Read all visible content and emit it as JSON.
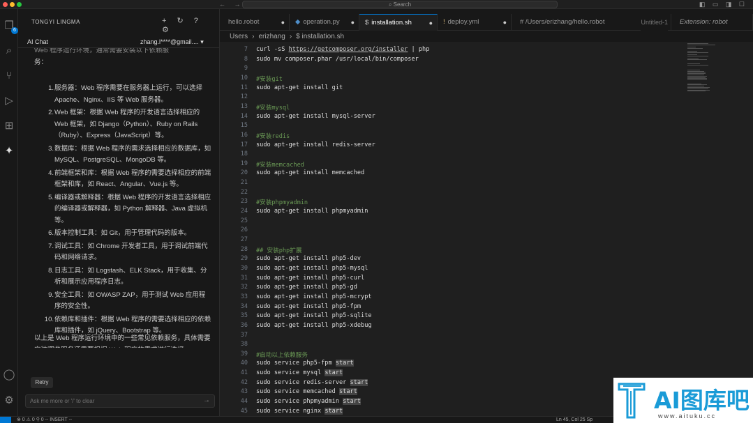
{
  "window": {
    "search_placeholder": "Search",
    "nav_back": "←",
    "nav_forward": "→",
    "layout_icons": "◧ ▭ ◨ ☐"
  },
  "activity_bar": {
    "explorer_badge": "6"
  },
  "sidebar": {
    "title": "TONGYI LINGMA",
    "actions": "+ ↻ ? ⚙",
    "chat_label": "AI Chat",
    "account": "zhang.l****@gmail....",
    "chat_top_line": "Web 程序运行环境，通常需要安装以下依赖服",
    "chat_top_line2": "务：",
    "chat_items": [
      {
        "n": "1.",
        "text": "服务器：Web 程序需要在服务器上运行，可以选择 Apache、Nginx、IIS 等 Web 服务器。"
      },
      {
        "n": "2.",
        "text": "Web 框架：根据 Web 程序的开发语言选择相应的 Web 框架，如 Django（Python）、Ruby on Rails（Ruby）、Express（JavaScript）等。"
      },
      {
        "n": "3.",
        "text": "数据库：根据 Web 程序的需求选择相应的数据库，如 MySQL、PostgreSQL、MongoDB 等。"
      },
      {
        "n": "4.",
        "text": "前端框架和库：根据 Web 程序的需要选择相应的前端框架和库，如 React、Angular、Vue.js 等。"
      },
      {
        "n": "5.",
        "text": "编译器或解释器：根据 Web 程序的开发语言选择相应的编译器或解释器，如 Python 解释器、Java 虚拟机等。"
      },
      {
        "n": "6.",
        "text": "版本控制工具：如 Git，用于管理代码的版本。"
      },
      {
        "n": "7.",
        "text": "调试工具：如 Chrome 开发者工具，用于调试前端代码和网络请求。"
      },
      {
        "n": "8.",
        "text": "日志工具：如 Logstash、ELK Stack，用于收集、分析和展示应用程序日志。"
      },
      {
        "n": "9.",
        "text": "安全工具：如 OWASP ZAP，用于测试 Web 应用程序的安全性。"
      },
      {
        "n": "10.",
        "text": "依赖库和插件：根据 Web 程序的需要选择相应的依赖库和插件，如 jQuery、Bootstrap 等。"
      }
    ],
    "chat_summary": "以上是 Web 程序运行环境中的一些常见依赖服务，具体需要安装哪些服务还需要根据 Web 程序的需求进行选择。",
    "retry_label": "Retry",
    "ask_placeholder": "Ask me more or '/' to clear",
    "send_icon": "→"
  },
  "tabs": [
    {
      "label": "hello.robot",
      "icon": "",
      "dirty": "●"
    },
    {
      "label": "operation.py",
      "icon": "◆",
      "dirty": "●"
    },
    {
      "label": "installation.sh",
      "icon": "$",
      "dirty": "●"
    },
    {
      "label": "deploy.yml",
      "icon": "!",
      "dirty": "●"
    },
    {
      "label": "# /Users/erizhang/hello.robot",
      "icon": "",
      "dirty": "Untitled-1"
    },
    {
      "label": "Extension: robot",
      "icon": "",
      "dirty": ""
    }
  ],
  "breadcrumb": {
    "parts": [
      "Users",
      "erizhang",
      "$ installation.sh"
    ],
    "sep": "›"
  },
  "code_lines": [
    {
      "n": "7",
      "parts": [
        [
          "curl -sS ",
          ""
        ],
        [
          "https://getcomposer.org/installer",
          "url"
        ],
        [
          " | php",
          ""
        ]
      ]
    },
    {
      "n": "8",
      "parts": [
        [
          "sudo mv composer.phar /usr/local/bin/composer",
          ""
        ]
      ]
    },
    {
      "n": "9",
      "parts": []
    },
    {
      "n": "10",
      "parts": [
        [
          "#安装git",
          "comment"
        ]
      ]
    },
    {
      "n": "11",
      "parts": [
        [
          "sudo apt-get install git",
          ""
        ]
      ]
    },
    {
      "n": "12",
      "parts": []
    },
    {
      "n": "13",
      "parts": [
        [
          "#安装mysql",
          "comment"
        ]
      ]
    },
    {
      "n": "14",
      "parts": [
        [
          "sudo apt-get install mysql-server",
          ""
        ]
      ]
    },
    {
      "n": "15",
      "parts": []
    },
    {
      "n": "16",
      "parts": [
        [
          "#安装redis",
          "comment"
        ]
      ]
    },
    {
      "n": "17",
      "parts": [
        [
          "sudo apt-get install redis-server",
          ""
        ]
      ]
    },
    {
      "n": "18",
      "parts": []
    },
    {
      "n": "19",
      "parts": [
        [
          "#安装memcached",
          "comment"
        ]
      ]
    },
    {
      "n": "20",
      "parts": [
        [
          "sudo apt-get install memcached",
          ""
        ]
      ]
    },
    {
      "n": "21",
      "parts": []
    },
    {
      "n": "22",
      "parts": []
    },
    {
      "n": "23",
      "parts": [
        [
          "#安装phpmyadmin",
          "comment"
        ]
      ]
    },
    {
      "n": "24",
      "parts": [
        [
          "sudo apt-get install phpmyadmin",
          ""
        ]
      ]
    },
    {
      "n": "25",
      "parts": []
    },
    {
      "n": "26",
      "parts": []
    },
    {
      "n": "27",
      "parts": []
    },
    {
      "n": "28",
      "parts": [
        [
          "## 安装php扩展",
          "comment"
        ]
      ]
    },
    {
      "n": "29",
      "parts": [
        [
          "sudo apt-get install php5-dev",
          ""
        ]
      ]
    },
    {
      "n": "30",
      "parts": [
        [
          "sudo apt-get install php5-mysql",
          ""
        ]
      ]
    },
    {
      "n": "31",
      "parts": [
        [
          "sudo apt-get install php5-curl",
          ""
        ]
      ]
    },
    {
      "n": "32",
      "parts": [
        [
          "sudo apt-get install php5-gd",
          ""
        ]
      ]
    },
    {
      "n": "33",
      "parts": [
        [
          "sudo apt-get install php5-mcrypt",
          ""
        ]
      ]
    },
    {
      "n": "34",
      "parts": [
        [
          "sudo apt-get install php5-fpm",
          ""
        ]
      ]
    },
    {
      "n": "35",
      "parts": [
        [
          "sudo apt-get install php5-sqlite",
          ""
        ]
      ]
    },
    {
      "n": "36",
      "parts": [
        [
          "sudo apt-get install php5-xdebug",
          ""
        ]
      ]
    },
    {
      "n": "37",
      "parts": []
    },
    {
      "n": "38",
      "parts": []
    },
    {
      "n": "39",
      "parts": [
        [
          "#启动以上依赖服务",
          "comment"
        ]
      ]
    },
    {
      "n": "40",
      "parts": [
        [
          "sudo service php5-fpm ",
          ""
        ],
        [
          "start",
          "hl"
        ]
      ]
    },
    {
      "n": "41",
      "parts": [
        [
          "sudo service mysql ",
          ""
        ],
        [
          "start",
          "hl"
        ]
      ]
    },
    {
      "n": "42",
      "parts": [
        [
          "sudo service redis-server ",
          ""
        ],
        [
          "start",
          "hl"
        ]
      ]
    },
    {
      "n": "43",
      "parts": [
        [
          "sudo service memcached ",
          ""
        ],
        [
          "start",
          "hl"
        ]
      ]
    },
    {
      "n": "44",
      "parts": [
        [
          "sudo service phpmyadmin ",
          ""
        ],
        [
          "start",
          "hl"
        ]
      ]
    },
    {
      "n": "45",
      "parts": [
        [
          "sudo service nginx ",
          ""
        ],
        [
          "start",
          "hl"
        ]
      ]
    }
  ],
  "status": {
    "left": "⊗ 0 ⚠ 0   ⚲ 0   -- INSERT --",
    "right": "Ln 45, Col 25   Sp"
  },
  "watermark": {
    "cn": "AI图库吧",
    "url": "www.aituku.cc"
  },
  "colors": {
    "accent": "#0078d4",
    "comment": "#6a9955",
    "watermark": "#1a9bd7"
  }
}
